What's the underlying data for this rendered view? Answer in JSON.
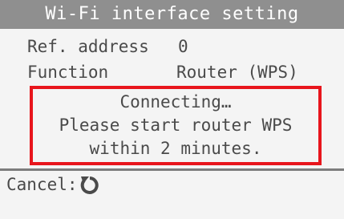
{
  "window": {
    "title": "Wi-Fi interface setting"
  },
  "settings": {
    "ref_address_label": "Ref. address",
    "ref_address_value": "0",
    "function_label": "Function",
    "function_value": "Router (WPS)"
  },
  "message": {
    "line1": "Connecting…",
    "line2": "Please start router WPS",
    "line3": "within 2 minutes."
  },
  "footer": {
    "cancel_label": "Cancel:",
    "cancel_icon": "return-arrow-icon"
  },
  "colors": {
    "title_background": "#8f8f8f",
    "highlight_border": "#e8151c",
    "text": "#4a4a4a"
  }
}
